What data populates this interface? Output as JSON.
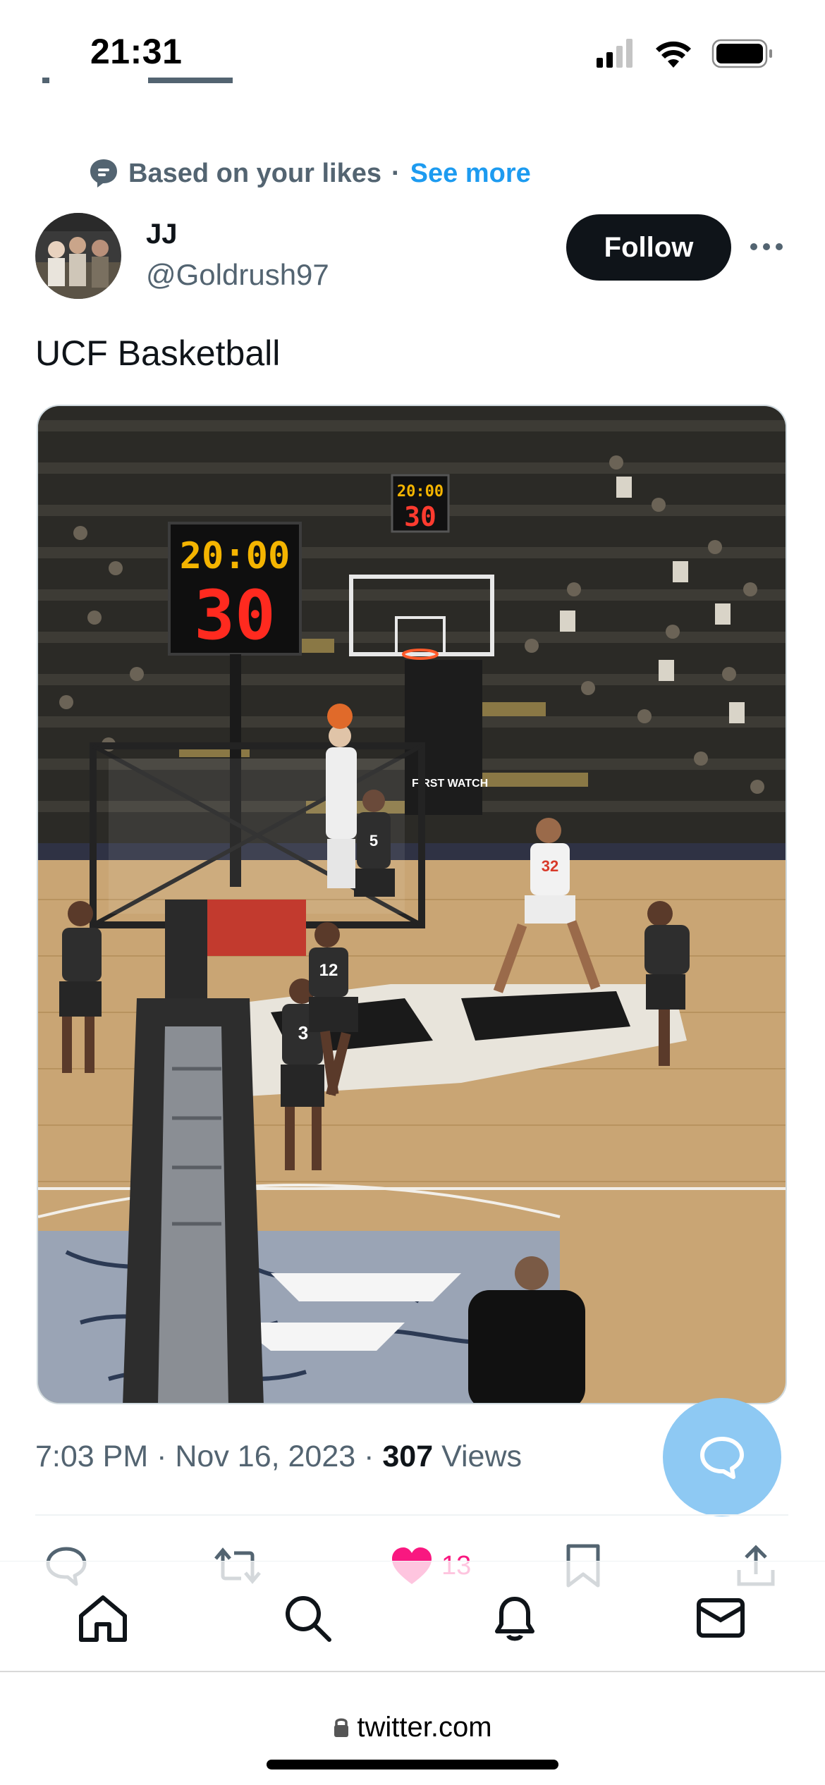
{
  "status_bar": {
    "time": "21:31",
    "icons": [
      "cellular-signal-icon",
      "wifi-icon",
      "battery-icon"
    ]
  },
  "tweet": {
    "social_context": {
      "icon": "heart-bubble-icon",
      "text": "Based on your likes",
      "separator": "·",
      "link": "See more"
    },
    "author": {
      "display_name": "JJ",
      "handle": "@Goldrush97",
      "follow_label": "Follow"
    },
    "text": "UCF Basketball",
    "media": {
      "scoreboard_main_time": "20:00",
      "scoreboard_main_shot": "30",
      "scoreboard_far_time": "20:00",
      "scoreboard_far_shot": "30",
      "jersey_numbers": [
        "3",
        "12",
        "32",
        "5"
      ]
    },
    "meta": {
      "time": "7:03 PM",
      "date": "Nov 16, 2023",
      "separator": " · ",
      "views_count": "307",
      "views_label": " Views"
    },
    "actions": {
      "like_count": "13"
    }
  },
  "bottom_nav": [
    "home-icon",
    "search-icon",
    "notifications-icon",
    "messages-icon"
  ],
  "browser": {
    "url": "twitter.com"
  },
  "colors": {
    "brand_blue": "#1d9bf0",
    "like_pink": "#f91880",
    "fab_blue": "#8ec9f3",
    "text_primary": "#0f1419",
    "text_secondary": "#536471"
  }
}
